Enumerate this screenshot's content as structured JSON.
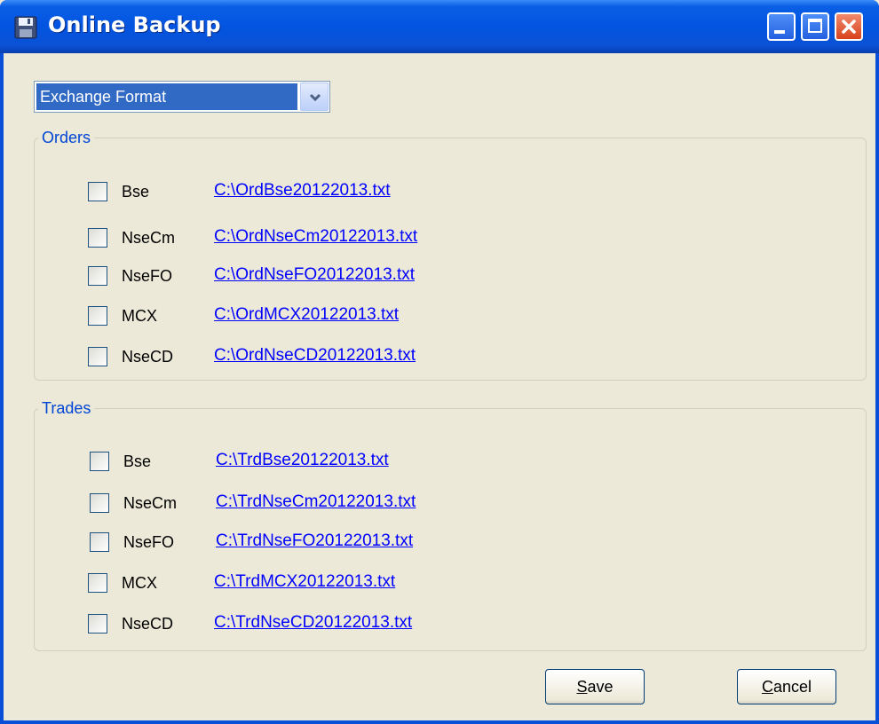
{
  "window": {
    "title": "Online Backup"
  },
  "icons": {
    "app": "floppy-disk-icon",
    "minimize": "minimize-icon",
    "maximize": "maximize-icon",
    "close": "close-icon",
    "dropdown": "chevron-down-icon"
  },
  "format_select": {
    "value": "Exchange Format"
  },
  "orders": {
    "title": "Orders",
    "items": [
      {
        "label": "Bse",
        "path": "C:\\OrdBse20122013.txt",
        "checked": false
      },
      {
        "label": "NseCm",
        "path": "C:\\OrdNseCm20122013.txt",
        "checked": false
      },
      {
        "label": "NseFO",
        "path": "C:\\OrdNseFO20122013.txt",
        "checked": false
      },
      {
        "label": "MCX",
        "path": "C:\\OrdMCX20122013.txt",
        "checked": false
      },
      {
        "label": "NseCD",
        "path": "C:\\OrdNseCD20122013.txt",
        "checked": false
      }
    ]
  },
  "trades": {
    "title": "Trades",
    "items": [
      {
        "label": "Bse",
        "path": "C:\\TrdBse20122013.txt",
        "checked": false
      },
      {
        "label": "NseCm",
        "path": "C:\\TrdNseCm20122013.txt",
        "checked": false
      },
      {
        "label": "NseFO",
        "path": "C:\\TrdNseFO20122013.txt",
        "checked": false
      },
      {
        "label": "MCX",
        "path": "C:\\TrdMCX20122013.txt",
        "checked": false
      },
      {
        "label": "NseCD",
        "path": "C:\\TrdNseCD20122013.txt",
        "checked": false
      }
    ]
  },
  "buttons": {
    "save": {
      "mnemonic": "S",
      "rest": "ave"
    },
    "cancel": {
      "mnemonic": "C",
      "rest": "ancel"
    }
  },
  "colors": {
    "title_bar": "#0254e0",
    "window_bg": "#ece9d8",
    "group_title": "#0046d5",
    "link": "#0000ff",
    "selection": "#316ac5"
  }
}
